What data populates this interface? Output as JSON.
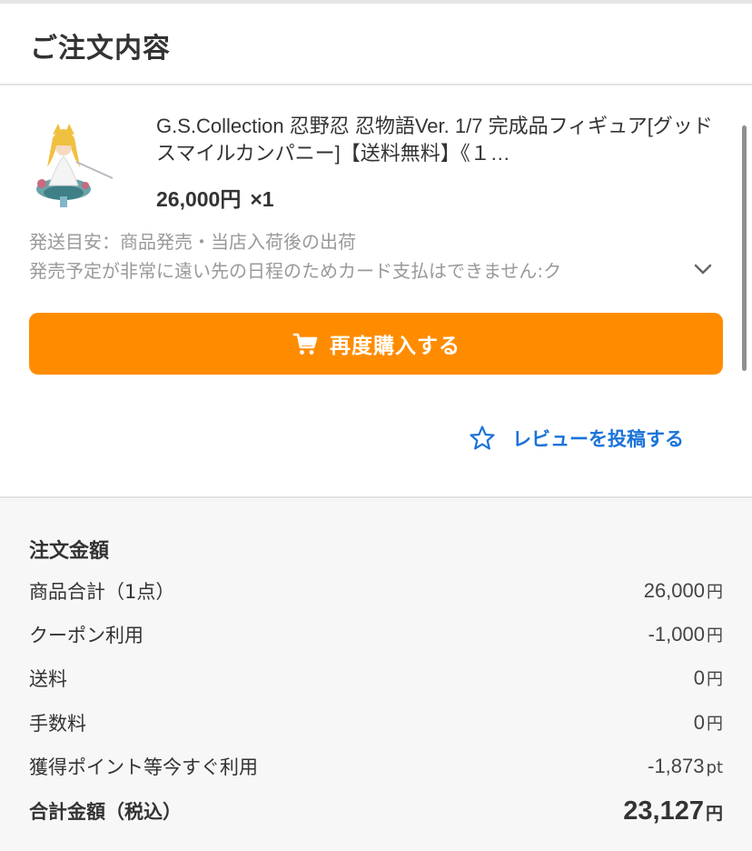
{
  "header": {
    "title": "ご注文内容"
  },
  "item": {
    "title": "G.S.Collection 忍野忍 忍物語Ver. 1/7 完成品フィギュア[グッドスマイルカンパニー]【送料無料】《１…",
    "price": "26,000円",
    "quantity": "×1",
    "shipping_note_line1": "発送目安：商品発売・当店入荷後の出荷",
    "shipping_note_line2": "発売予定が非常に遠い先の日程のためカード支払はできません:ク",
    "rebuy_label": "再度購入する",
    "review_label": "レビューを投稿する"
  },
  "summary": {
    "title": "注文金額",
    "rows": [
      {
        "label": "商品合計（1点）",
        "amount": "26,000",
        "unit": "円"
      },
      {
        "label": "クーポン利用",
        "amount": "-1,000",
        "unit": "円"
      },
      {
        "label": "送料",
        "amount": "0",
        "unit": "円"
      },
      {
        "label": "手数料",
        "amount": "0",
        "unit": "円"
      },
      {
        "label": "獲得ポイント等今すぐ利用",
        "amount": "-1,873",
        "unit": "pt"
      }
    ],
    "total": {
      "label": "合計金額（税込）",
      "amount": "23,127",
      "unit": "円"
    }
  },
  "colors": {
    "accent": "#ff8c00",
    "link": "#1a73d9",
    "muted": "#9a9a9a"
  },
  "icons": {
    "cart": "cart-icon",
    "star": "star-outline-icon",
    "chevron": "chevron-down-icon"
  }
}
